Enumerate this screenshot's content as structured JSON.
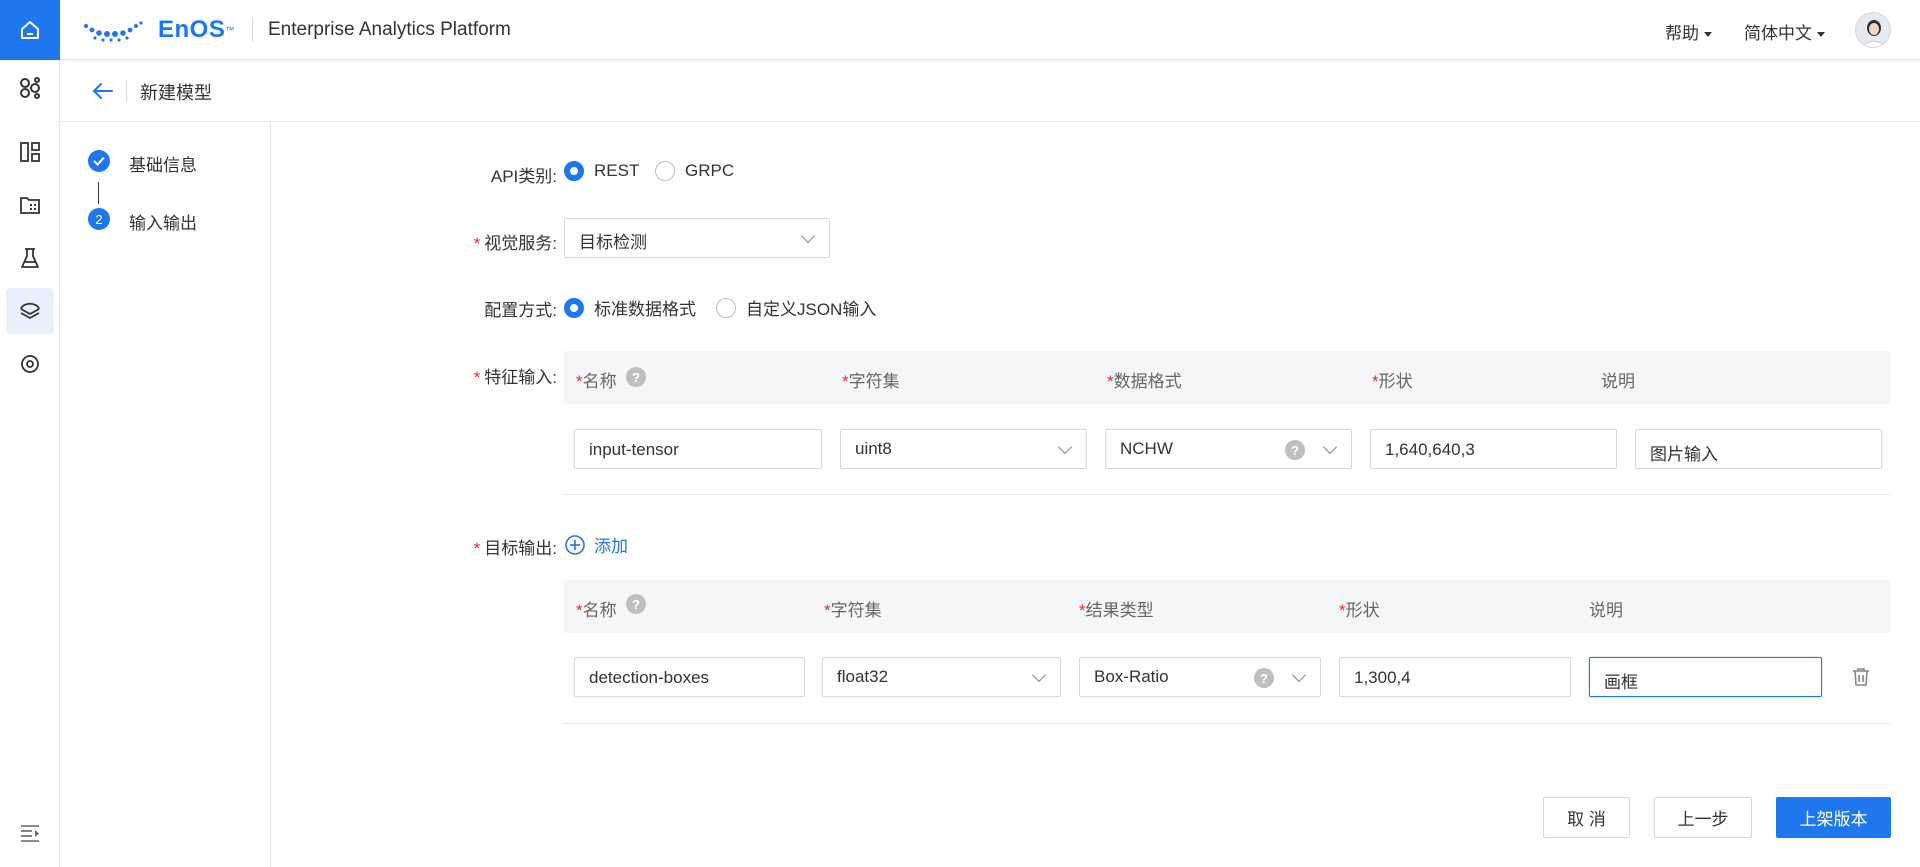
{
  "header": {
    "brand": "EnOS",
    "brand_tm": "™",
    "app_title": "Enterprise Analytics Platform",
    "help_label": "帮助",
    "language_label": "简体中文"
  },
  "breadcrumb": {
    "title": "新建模型"
  },
  "steps": [
    {
      "label": "基础信息",
      "status": "done"
    },
    {
      "number": "2",
      "label": "输入输出",
      "status": "current"
    }
  ],
  "form": {
    "api_type": {
      "label": "API类别:",
      "options": [
        "REST",
        "GRPC"
      ],
      "selected": "REST"
    },
    "vision_service": {
      "label": "视觉服务:",
      "value": "目标检测"
    },
    "config_mode": {
      "label": "配置方式:",
      "options": [
        "标准数据格式",
        "自定义JSON输入"
      ],
      "selected": "标准数据格式"
    },
    "feature_input": {
      "label": "特征输入:",
      "columns": [
        "名称",
        "字符集",
        "数据格式",
        "形状",
        "说明"
      ],
      "rows": [
        {
          "name": "input-tensor",
          "charset": "uint8",
          "format": "NCHW",
          "shape": "1,640,640,3",
          "desc": "图片输入"
        }
      ]
    },
    "target_output": {
      "label": "目标输出:",
      "add_label": "添加",
      "columns": [
        "名称",
        "字符集",
        "结果类型",
        "形状",
        "说明"
      ],
      "rows": [
        {
          "name": "detection-boxes",
          "charset": "float32",
          "result_type": "Box-Ratio",
          "shape": "1,300,4",
          "desc": "画框"
        }
      ]
    }
  },
  "footer": {
    "cancel_label": "取 消",
    "prev_label": "上一步",
    "publish_label": "上架版本"
  },
  "colors": {
    "primary": "#1f77f0",
    "required": "#f5222d"
  }
}
